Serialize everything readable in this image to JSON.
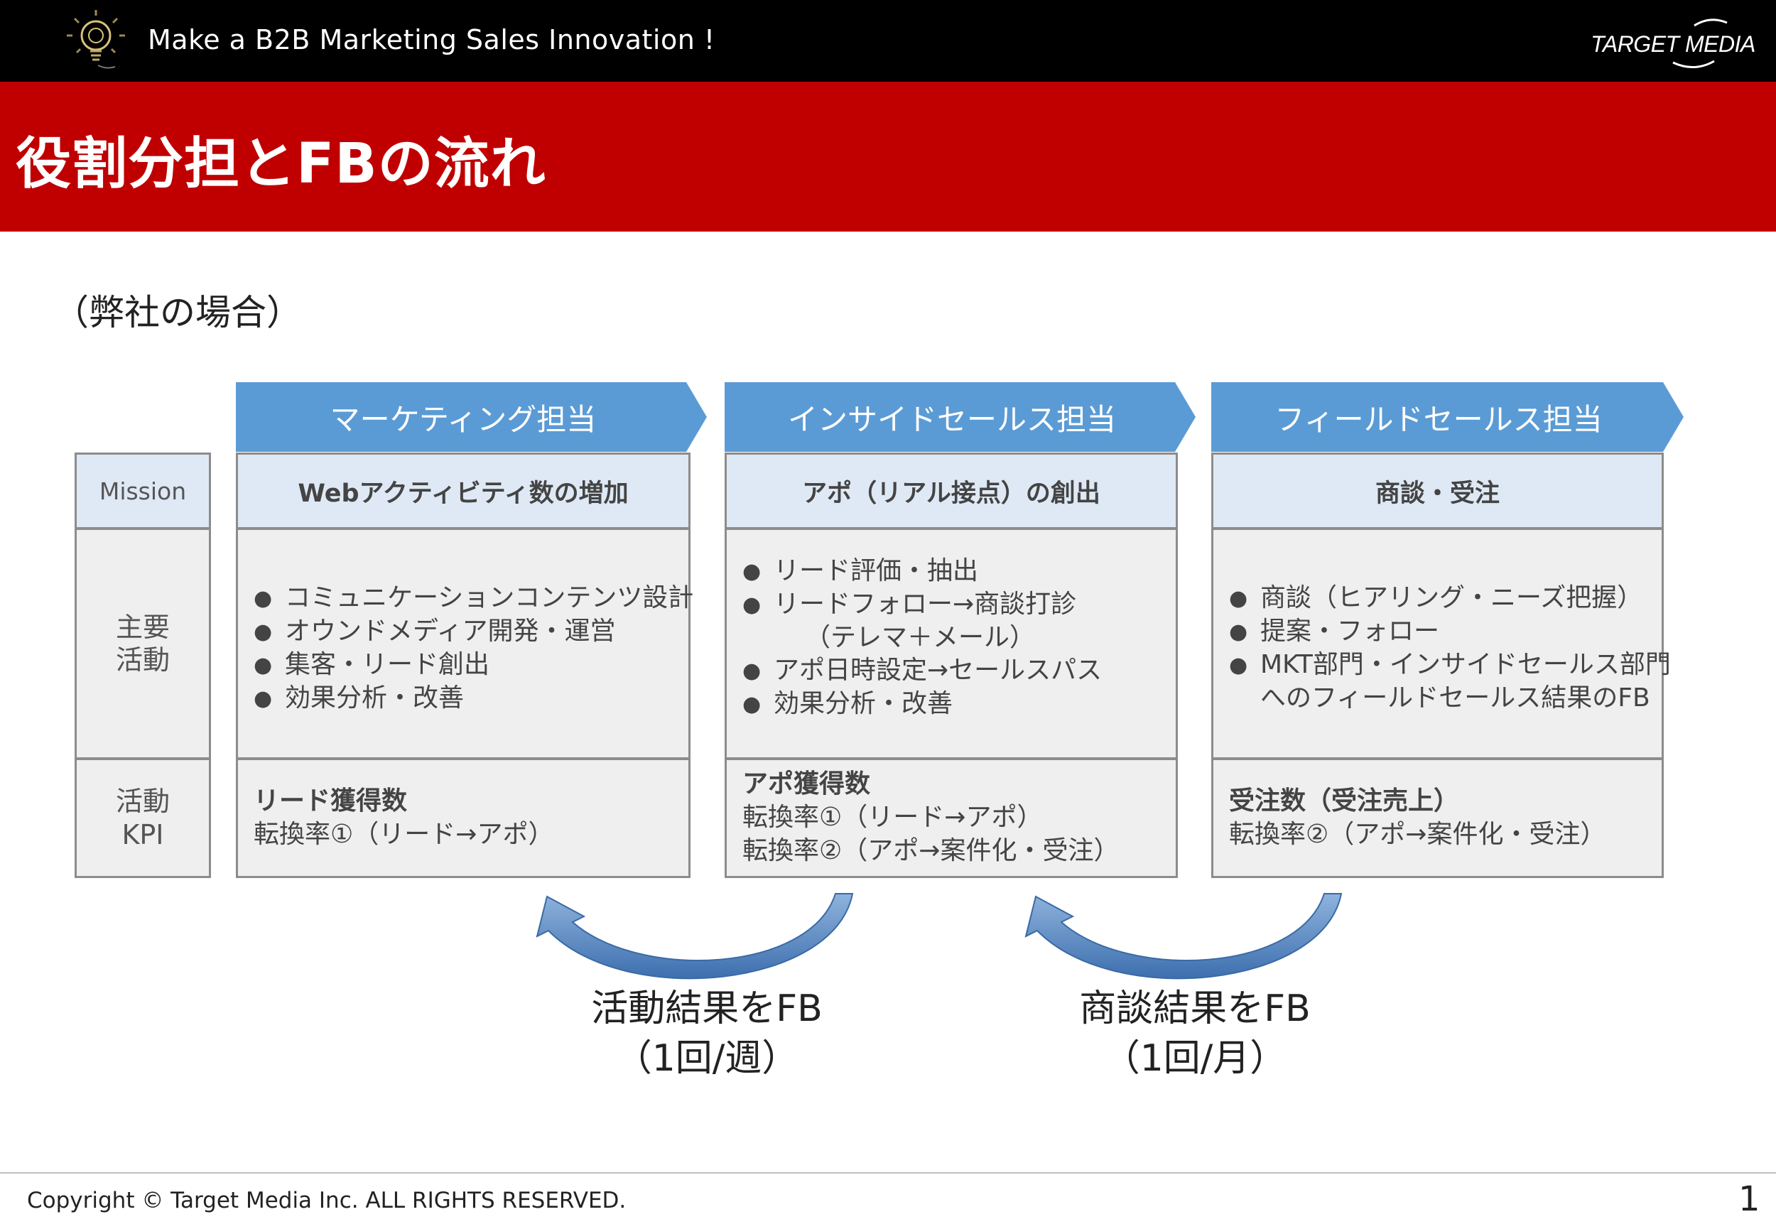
{
  "header": {
    "tagline": "Make a B2B Marketing Sales Innovation !",
    "logo_text": "TARGET MEDIA"
  },
  "title": "役割分担とFBの流れ",
  "subtitle": "（弊社の場合）",
  "row_labels": {
    "mission": "Mission",
    "activities": [
      "主要",
      "活動"
    ],
    "kpi": [
      "活動",
      "KPI"
    ]
  },
  "columns": [
    {
      "header": "マーケティング担当",
      "mission": "Webアクティビティ数の増加",
      "activities": [
        {
          "text": "コミュニケーションコンテンツ設計",
          "bullet": true
        },
        {
          "text": "オウンドメディア開発・運営",
          "bullet": true
        },
        {
          "text": "集客・リード創出",
          "bullet": true
        },
        {
          "text": "効果分析・改善",
          "bullet": true
        }
      ],
      "kpi_bold": "リード獲得数",
      "kpi_lines": [
        "転換率①（リード→アポ）"
      ]
    },
    {
      "header": "インサイドセールス担当",
      "mission": "アポ（リアル接点）の創出",
      "activities": [
        {
          "text": "リード評価・抽出",
          "bullet": true
        },
        {
          "text": "リードフォロー→商談打診",
          "bullet": true
        },
        {
          "text": "（テレマ＋メール）",
          "bullet": false
        },
        {
          "text": "アポ日時設定→セールスパス",
          "bullet": true
        },
        {
          "text": "効果分析・改善",
          "bullet": true
        }
      ],
      "kpi_bold": "アポ獲得数",
      "kpi_lines": [
        "転換率①（リード→アポ）",
        "転換率②（アポ→案件化・受注）"
      ]
    },
    {
      "header": "フィールドセールス担当",
      "mission": "商談・受注",
      "activities": [
        {
          "text": "商談（ヒアリング・ニーズ把握）",
          "bullet": true
        },
        {
          "text": "提案・フォロー",
          "bullet": true
        },
        {
          "text": "MKT部門・インサイドセールス部門",
          "bullet": true
        },
        {
          "text": "へのフィールドセールス結果のFB",
          "bullet": false
        }
      ],
      "kpi_bold": "受注数（受注売上）",
      "kpi_lines": [
        "転換率②（アポ→案件化・受注）"
      ]
    }
  ],
  "feedback": [
    {
      "line1": "活動結果をFB",
      "line2": "（1回/週）"
    },
    {
      "line1": "商談結果をFB",
      "line2": "（1回/月）"
    }
  ],
  "footer": {
    "copyright": "Copyright © Target Media Inc. ALL RIGHTS RESERVED.",
    "page_number": "1"
  },
  "colors": {
    "header_black": "#000000",
    "title_red": "#c00000",
    "column_header_blue": "#5b9bd5",
    "mission_fill": "#dfe9f5",
    "box_fill": "#efefef",
    "arrow_blue": "#4a7fbf"
  }
}
